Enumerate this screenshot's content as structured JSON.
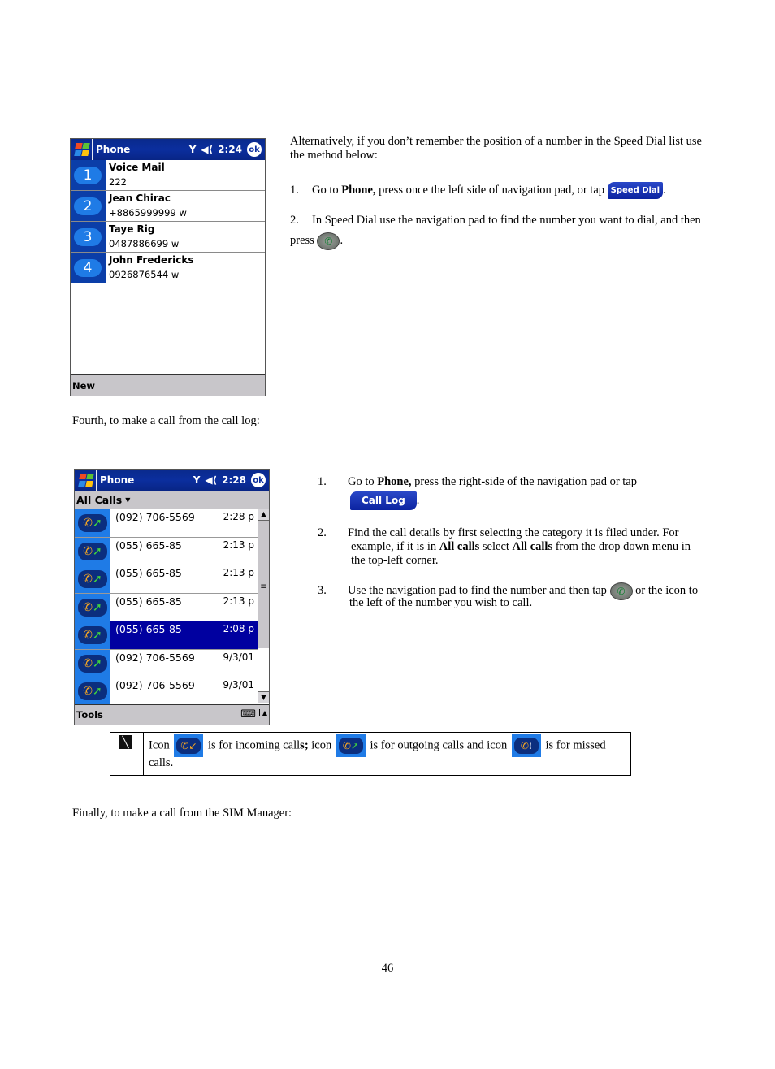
{
  "speed_dial_screen": {
    "title": "Phone",
    "time": "2:24",
    "ok_label": "ok",
    "icons": [
      "windows-start-icon",
      "signal-antenna-icon",
      "speaker-volume-icon"
    ],
    "entries": [
      {
        "slot": "1",
        "name": "Voice Mail",
        "number": "222"
      },
      {
        "slot": "2",
        "name": "Jean Chirac",
        "number": "+8865999999 w"
      },
      {
        "slot": "3",
        "name": "Taye Rig",
        "number": "0487886699 w"
      },
      {
        "slot": "4",
        "name": "John Fredericks",
        "number": "0926876544 w"
      }
    ],
    "menu": "New"
  },
  "intro": {
    "text": "Alternatively, if you don’t remember the position of a number in the Speed Dial list use the method below:"
  },
  "speed_dial_steps": [
    {
      "num": "1.",
      "pre": "Go to ",
      "bold": "Phone,",
      "post": " press once the left side of navigation pad, or tap ",
      "button": "Speed Dial",
      "end": "."
    },
    {
      "num": "2.",
      "pre": "In Speed Dial use the navigation pad to find the number you want to dial, and then press ",
      "end": "."
    }
  ],
  "fourth_heading": "Fourth, to make a call from the call log:",
  "call_log_screen": {
    "title": "Phone",
    "time": "2:28",
    "ok_label": "ok",
    "filter": "All Calls",
    "calls": [
      {
        "number": "(092) 706-5569",
        "time": "2:28 p",
        "type": "outgoing",
        "selected": false
      },
      {
        "number": "(055) 665-85",
        "time": "2:13 p",
        "type": "outgoing",
        "selected": false
      },
      {
        "number": "(055) 665-85",
        "time": "2:13 p",
        "type": "outgoing",
        "selected": false
      },
      {
        "number": "(055) 665-85",
        "time": "2:13 p",
        "type": "outgoing",
        "selected": false
      },
      {
        "number": "(055) 665-85",
        "time": "2:08 p",
        "type": "outgoing",
        "selected": true
      },
      {
        "number": "(092) 706-5569",
        "time": "9/3/01",
        "type": "outgoing",
        "selected": false
      },
      {
        "number": "(092) 706-5569",
        "time": "9/3/01",
        "type": "outgoing",
        "selected": false
      }
    ],
    "menu": "Tools"
  },
  "call_log_steps": [
    {
      "num": "1.",
      "pre": "Go to ",
      "bold": "Phone,",
      "post": " press the right-side of the navigation pad or tap",
      "button": "Call Log",
      "end": "."
    },
    {
      "num": "2.",
      "line1": "Find the call details by first selecting the category it is filed under. For",
      "line2_pre": "example, if it is in ",
      "line2_b1": "All calls",
      "line2_mid": " select ",
      "line2_b2": "All calls",
      "line2_post": " from the drop down menu in",
      "line3": "the top-left corner."
    },
    {
      "num": "3.",
      "pre": "Use the navigation pad to find the number and then tap ",
      "post": " or the icon to",
      "line2": "the left of the number you wish to call."
    }
  ],
  "note": {
    "t1": "Icon ",
    "t2": " is for incoming call",
    "t2b": "s;",
    "t3": " icon ",
    "t4": " is for outgoing calls and icon ",
    "t5": " is for missed",
    "t6": "calls."
  },
  "final_heading": "Finally, to make a call from the SIM Manager:",
  "page_number": "46"
}
